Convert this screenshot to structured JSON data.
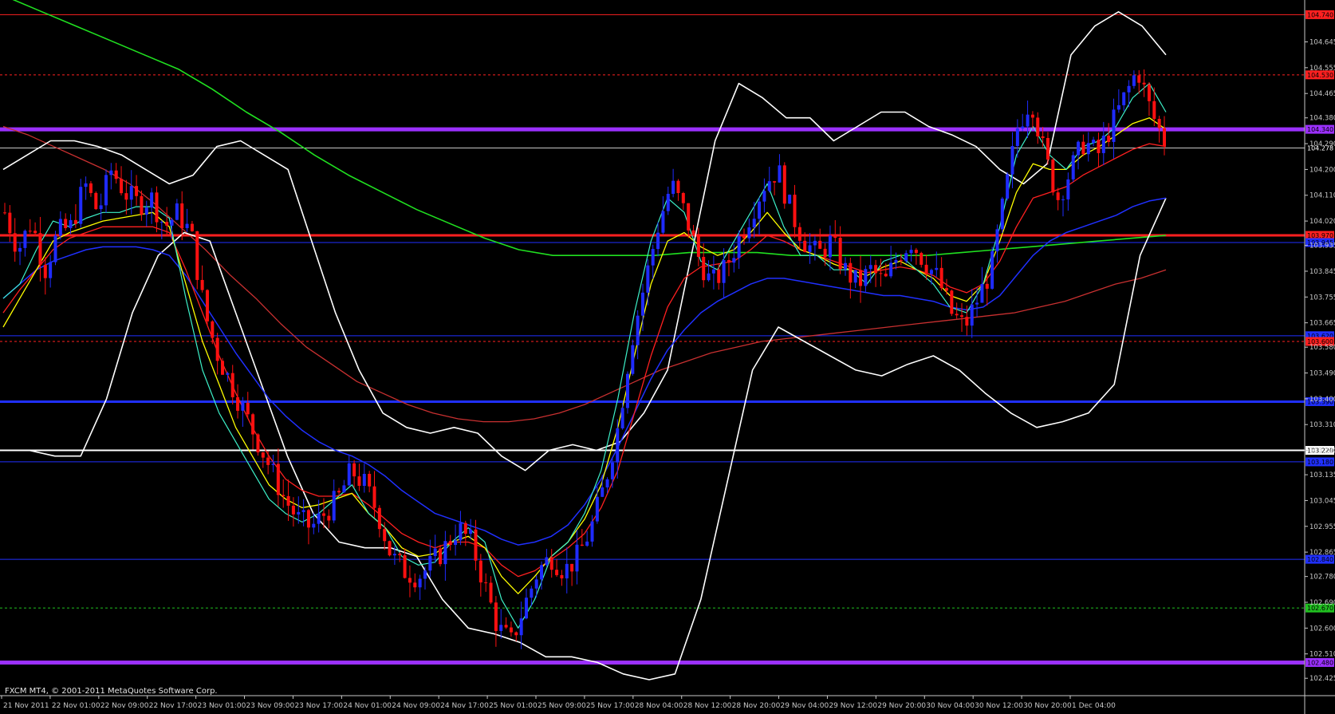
{
  "window": {
    "copyright": "FXCM MT4, © 2001-2011 MetaQuotes Software Corp."
  },
  "colors": {
    "background": "#000000",
    "bull_candle": "#1f2bff",
    "bear_candle": "#ff1010",
    "ema_fast": "#3df0c8",
    "ema_yellow": "#ffff00",
    "ema_red": "#ff2020",
    "ema_blue": "#2030ff",
    "sma_darkred": "#c83030",
    "sma_green": "#20e020",
    "bollinger": "#ffffff",
    "purple_level": "#9b30ff"
  },
  "price_axis": {
    "min": 102.42,
    "max": 104.78,
    "ticks": [
      "104.645",
      "104.555",
      "104.465",
      "104.380",
      "104.290",
      "104.200",
      "104.110",
      "104.020",
      "103.935",
      "103.845",
      "103.755",
      "103.665",
      "103.580",
      "103.490",
      "103.400",
      "103.310",
      "103.220",
      "103.135",
      "103.045",
      "102.955",
      "102.865",
      "102.780",
      "102.690",
      "102.600",
      "102.510",
      "102.425"
    ]
  },
  "time_axis": {
    "labels": [
      "21 Nov 2011",
      "22 Nov 01:00",
      "22 Nov 09:00",
      "22 Nov 17:00",
      "23 Nov 01:00",
      "23 Nov 09:00",
      "23 Nov 17:00",
      "24 Nov 01:00",
      "24 Nov 09:00",
      "24 Nov 17:00",
      "25 Nov 01:00",
      "25 Nov 09:00",
      "25 Nov 17:00",
      "28 Nov 04:00",
      "28 Nov 12:00",
      "28 Nov 20:00",
      "29 Nov 04:00",
      "29 Nov 12:00",
      "29 Nov 20:00",
      "30 Nov 04:00",
      "30 Nov 12:00",
      "30 Nov 20:00",
      "1 Dec 04:00"
    ]
  },
  "levels": [
    {
      "price": 104.74,
      "label": "104.740",
      "color": "#ff2020",
      "style": "solid",
      "width": 1,
      "tag_bg": "#ff2020",
      "tag_fg": "#000000"
    },
    {
      "price": 104.53,
      "label": "104.530",
      "color": "#ff2020",
      "style": "dashed",
      "width": 1,
      "tag_bg": "#ff2020",
      "tag_fg": "#000000"
    },
    {
      "price": 104.34,
      "label": "104.340",
      "color": "#9b30ff",
      "style": "solid",
      "width": 5,
      "tag_bg": "#9b30ff",
      "tag_fg": "#000000"
    },
    {
      "price": 104.275,
      "label": "104.278",
      "color": "#c8c8c8",
      "style": "solid",
      "width": 1,
      "tag_bg": "#000000",
      "tag_fg": "#ffffff"
    },
    {
      "price": 103.97,
      "label": "103.970",
      "color": "#ff2020",
      "style": "solid",
      "width": 3,
      "tag_bg": "#ff2020",
      "tag_fg": "#000000"
    },
    {
      "price": 103.945,
      "label": "103.945",
      "color": "#2030ff",
      "style": "solid",
      "width": 1,
      "tag_bg": "#2030ff",
      "tag_fg": "#000000"
    },
    {
      "price": 103.62,
      "label": "103.620",
      "color": "#2030ff",
      "style": "solid",
      "width": 1,
      "tag_bg": "#2030ff",
      "tag_fg": "#000000"
    },
    {
      "price": 103.6,
      "label": "103.600",
      "color": "#ff2020",
      "style": "dashed",
      "width": 1,
      "tag_bg": "#ff2020",
      "tag_fg": "#000000"
    },
    {
      "price": 103.39,
      "label": "103.390",
      "color": "#2030ff",
      "style": "solid",
      "width": 3,
      "tag_bg": "#2030ff",
      "tag_fg": "#000000"
    },
    {
      "price": 103.22,
      "label": "103.220",
      "color": "#ffffff",
      "style": "solid",
      "width": 2,
      "tag_bg": "#ffffff",
      "tag_fg": "#000000"
    },
    {
      "price": 103.18,
      "label": "103.180",
      "color": "#2030ff",
      "style": "solid",
      "width": 1,
      "tag_bg": "#2030ff",
      "tag_fg": "#000000"
    },
    {
      "price": 102.84,
      "label": "102.840",
      "color": "#2030ff",
      "style": "solid",
      "width": 1,
      "tag_bg": "#2030ff",
      "tag_fg": "#000000"
    },
    {
      "price": 102.67,
      "label": "102.670",
      "color": "#20c020",
      "style": "dashed",
      "width": 1,
      "tag_bg": "#20c020",
      "tag_fg": "#000000"
    },
    {
      "price": 102.48,
      "label": "102.480",
      "color": "#9b30ff",
      "style": "solid",
      "width": 5,
      "tag_bg": "#9b30ff",
      "tag_fg": "#000000"
    }
  ],
  "chart_data": {
    "type": "candlestick",
    "symbol": "",
    "candle_count": 230,
    "ohlc_path": [
      104.05,
      103.92,
      104.02,
      103.85,
      103.98,
      104.0,
      104.15,
      104.05,
      104.2,
      104.12,
      104.08,
      104.1,
      104.0,
      104.05,
      103.97,
      103.7,
      103.55,
      103.45,
      103.35,
      103.25,
      103.15,
      103.05,
      102.98,
      102.95,
      103.0,
      103.05,
      103.15,
      103.1,
      103.0,
      102.85,
      102.8,
      102.78,
      102.82,
      102.88,
      102.95,
      102.9,
      102.75,
      102.6,
      102.55,
      102.68,
      102.8,
      102.85,
      102.8,
      102.85,
      102.95,
      103.1,
      103.3,
      103.6,
      103.8,
      104.0,
      104.15,
      104.05,
      103.9,
      103.8,
      103.85,
      103.95,
      104.05,
      104.15,
      104.2,
      104.05,
      103.95,
      103.9,
      103.95,
      103.85,
      103.8,
      103.85,
      103.8,
      103.9,
      103.95,
      103.88,
      103.82,
      103.7,
      103.65,
      103.75,
      103.85,
      104.1,
      104.35,
      104.45,
      104.25,
      104.1,
      104.2,
      104.3,
      104.25,
      104.35,
      104.45,
      104.55,
      104.4,
      104.3
    ],
    "ema_fast": [
      103.75,
      103.8,
      103.92,
      104.02,
      104.0,
      104.03,
      104.05,
      104.05,
      104.07,
      104.07,
      104.03,
      103.75,
      103.5,
      103.35,
      103.25,
      103.15,
      103.05,
      103.0,
      102.97,
      103.0,
      103.05,
      103.1,
      103.0,
      102.95,
      102.85,
      102.82,
      102.83,
      102.9,
      102.95,
      102.9,
      102.7,
      102.6,
      102.7,
      102.85,
      102.9,
      103.0,
      103.15,
      103.4,
      103.7,
      103.95,
      104.1,
      104.05,
      103.88,
      103.85,
      103.95,
      104.05,
      104.15,
      104.0,
      103.9,
      103.9,
      103.85,
      103.85,
      103.8,
      103.88,
      103.9,
      103.85,
      103.8,
      103.72,
      103.7,
      103.8,
      104.0,
      104.25,
      104.35,
      104.25,
      104.2,
      104.28,
      104.3,
      104.35,
      104.45,
      104.5,
      104.4
    ],
    "ema_yellow": [
      103.65,
      103.75,
      103.85,
      103.95,
      103.98,
      104.0,
      104.02,
      104.03,
      104.04,
      104.05,
      104.0,
      103.8,
      103.6,
      103.45,
      103.3,
      103.2,
      103.1,
      103.05,
      103.02,
      103.03,
      103.05,
      103.07,
      103.0,
      102.95,
      102.88,
      102.85,
      102.86,
      102.9,
      102.92,
      102.88,
      102.78,
      102.72,
      102.78,
      102.85,
      102.9,
      102.98,
      103.1,
      103.3,
      103.55,
      103.8,
      103.95,
      103.98,
      103.93,
      103.9,
      103.92,
      103.98,
      104.05,
      103.98,
      103.92,
      103.9,
      103.87,
      103.85,
      103.83,
      103.86,
      103.88,
      103.85,
      103.82,
      103.76,
      103.74,
      103.8,
      103.95,
      104.12,
      104.22,
      104.2,
      104.2,
      104.25,
      104.28,
      104.32,
      104.36,
      104.38,
      104.34
    ],
    "ema_red": [
      103.7,
      103.78,
      103.85,
      103.92,
      103.96,
      103.98,
      104.0,
      104.0,
      104.0,
      104.0,
      103.98,
      103.85,
      103.7,
      103.55,
      103.42,
      103.3,
      103.2,
      103.12,
      103.08,
      103.06,
      103.06,
      103.07,
      103.03,
      102.98,
      102.93,
      102.9,
      102.88,
      102.9,
      102.9,
      102.88,
      102.82,
      102.78,
      102.8,
      102.84,
      102.88,
      102.93,
      103.02,
      103.15,
      103.35,
      103.55,
      103.72,
      103.82,
      103.86,
      103.87,
      103.88,
      103.92,
      103.97,
      103.95,
      103.92,
      103.9,
      103.88,
      103.86,
      103.84,
      103.85,
      103.86,
      103.85,
      103.83,
      103.79,
      103.77,
      103.8,
      103.88,
      104.0,
      104.1,
      104.12,
      104.14,
      104.18,
      104.21,
      104.24,
      104.27,
      104.29,
      104.28
    ],
    "ema_blue": [
      103.75,
      103.8,
      103.85,
      103.88,
      103.9,
      103.92,
      103.93,
      103.93,
      103.93,
      103.92,
      103.9,
      103.83,
      103.74,
      103.65,
      103.56,
      103.48,
      103.4,
      103.34,
      103.29,
      103.25,
      103.22,
      103.2,
      103.17,
      103.13,
      103.08,
      103.04,
      103.0,
      102.98,
      102.96,
      102.94,
      102.91,
      102.89,
      102.9,
      102.92,
      102.96,
      103.03,
      103.12,
      103.23,
      103.35,
      103.47,
      103.57,
      103.64,
      103.7,
      103.74,
      103.77,
      103.8,
      103.82,
      103.82,
      103.81,
      103.8,
      103.79,
      103.78,
      103.77,
      103.76,
      103.76,
      103.75,
      103.74,
      103.72,
      103.71,
      103.72,
      103.76,
      103.83,
      103.9,
      103.95,
      103.98,
      104.0,
      104.02,
      104.04,
      104.07,
      104.09,
      104.1
    ],
    "sma_darkred": [
      104.35,
      104.32,
      104.28,
      104.24,
      104.2,
      104.15,
      104.08,
      104.0,
      103.92,
      103.83,
      103.75,
      103.66,
      103.58,
      103.52,
      103.46,
      103.42,
      103.38,
      103.35,
      103.33,
      103.32,
      103.32,
      103.33,
      103.35,
      103.38,
      103.42,
      103.46,
      103.5,
      103.53,
      103.56,
      103.58,
      103.6,
      103.61,
      103.62,
      103.63,
      103.64,
      103.65,
      103.66,
      103.67,
      103.68,
      103.69,
      103.7,
      103.72,
      103.74,
      103.77,
      103.8,
      103.82,
      103.85
    ],
    "sma_green": [
      104.8,
      104.75,
      104.7,
      104.65,
      104.6,
      104.55,
      104.48,
      104.4,
      104.33,
      104.25,
      104.18,
      104.12,
      104.06,
      104.01,
      103.96,
      103.92,
      103.9,
      103.9,
      103.9,
      103.9,
      103.91,
      103.91,
      103.91,
      103.9,
      103.9,
      103.9,
      103.9,
      103.9,
      103.91,
      103.92,
      103.93,
      103.94,
      103.95,
      103.96,
      103.97
    ],
    "bb_upper": [
      104.2,
      104.25,
      104.3,
      104.3,
      104.28,
      104.25,
      104.2,
      104.15,
      104.18,
      104.28,
      104.3,
      104.25,
      104.2,
      103.95,
      103.7,
      103.5,
      103.35,
      103.3,
      103.28,
      103.3,
      103.28,
      103.2,
      103.15,
      103.22,
      103.24,
      103.22,
      103.25,
      103.35,
      103.5,
      103.9,
      104.3,
      104.5,
      104.45,
      104.38,
      104.38,
      104.3,
      104.35,
      104.4,
      104.4,
      104.35,
      104.32,
      104.28,
      104.2,
      104.15,
      104.22,
      104.6,
      104.7,
      104.75,
      104.7,
      104.6
    ],
    "bb_lower": [
      103.22,
      103.22,
      103.2,
      103.2,
      103.4,
      103.7,
      103.9,
      103.98,
      103.95,
      103.7,
      103.45,
      103.2,
      103.0,
      102.9,
      102.88,
      102.88,
      102.85,
      102.7,
      102.6,
      102.58,
      102.55,
      102.5,
      102.5,
      102.48,
      102.44,
      102.42,
      102.44,
      102.7,
      103.1,
      103.5,
      103.65,
      103.6,
      103.55,
      103.5,
      103.48,
      103.52,
      103.55,
      103.5,
      103.42,
      103.35,
      103.3,
      103.32,
      103.35,
      103.45,
      103.9,
      104.1
    ]
  }
}
